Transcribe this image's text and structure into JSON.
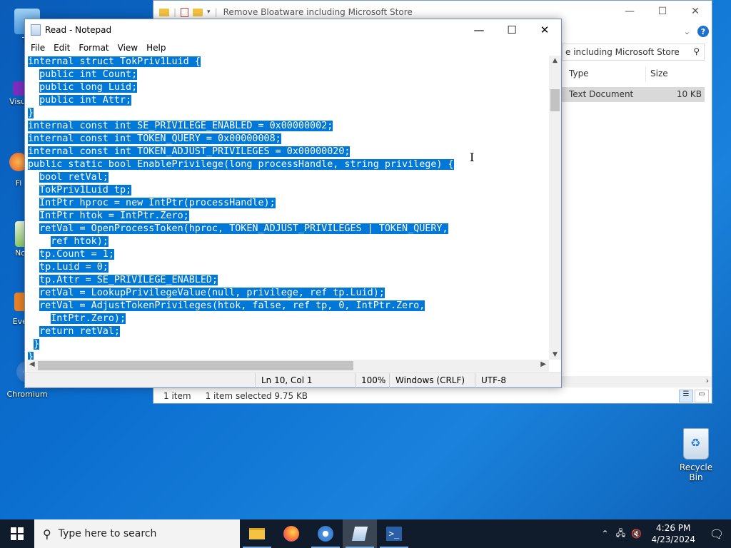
{
  "desktop": {
    "icons": [
      {
        "label": "Th"
      },
      {
        "label": "Visua"
      },
      {
        "label": "Fi"
      },
      {
        "label": "Note"
      },
      {
        "label": "Ever"
      },
      {
        "label": "Chromium"
      }
    ],
    "recycle_bin_label": "Recycle Bin"
  },
  "explorer": {
    "title": "Remove Bloatware including Microsoft Store",
    "search_text": "e including Microsoft Store",
    "columns": {
      "type": "Type",
      "size": "Size"
    },
    "row": {
      "type": "Text Document",
      "size": "10 KB"
    },
    "status": {
      "count": "1 item",
      "selected": "1 item selected  9.75 KB"
    }
  },
  "notepad": {
    "title": "Read - Notepad",
    "menu": [
      "File",
      "Edit",
      "Format",
      "View",
      "Help"
    ],
    "content_lines": [
      "internal struct TokPriv1Luid {",
      "  public int Count;",
      "  public long Luid;",
      "  public int Attr;",
      "}",
      "internal const int SE_PRIVILEGE_ENABLED = 0x00000002;",
      "internal const int TOKEN_QUERY = 0x00000008;",
      "internal const int TOKEN_ADJUST_PRIVILEGES = 0x00000020;",
      "public static bool EnablePrivilege(long processHandle, string privilege) {",
      "  bool retVal;",
      "  TokPriv1Luid tp;",
      "  IntPtr hproc = new IntPtr(processHandle);",
      "  IntPtr htok = IntPtr.Zero;",
      "  retVal = OpenProcessToken(hproc, TOKEN_ADJUST_PRIVILEGES | TOKEN_QUERY,",
      "    ref htok);",
      "  tp.Count = 1;",
      "  tp.Luid = 0;",
      "  tp.Attr = SE_PRIVILEGE_ENABLED;",
      "  retVal = LookupPrivilegeValue(null, privilege, ref tp.Luid);",
      "  retVal = AdjustTokenPrivileges(htok, false, ref tp, 0, IntPtr.Zero,",
      "    IntPtr.Zero);",
      "  return retVal;",
      " }",
      "}"
    ],
    "status": {
      "position": "Ln 10, Col 1",
      "zoom": "100%",
      "line_ending": "Windows (CRLF)",
      "encoding": "UTF-8"
    },
    "selection_color": "#0078d7"
  },
  "taskbar": {
    "search_placeholder": "Type here to search",
    "apps": [
      "file-explorer",
      "firefox",
      "chromium",
      "notepad",
      "powershell"
    ],
    "clock_time": "4:26 PM",
    "clock_date": "4/23/2024"
  }
}
